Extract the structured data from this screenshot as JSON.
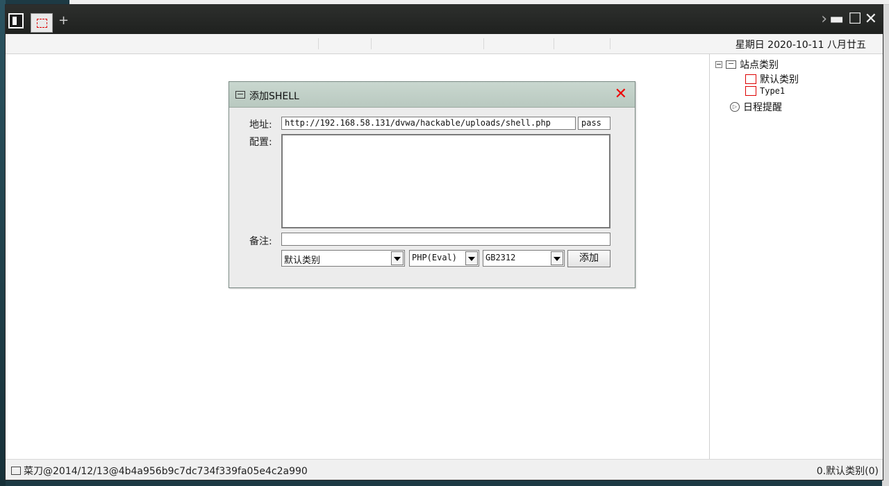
{
  "window": {
    "date": "星期日 2020-10-11 八月廿五"
  },
  "tree": {
    "root": "站点类别",
    "children": [
      "默认类别",
      "Type1"
    ],
    "schedule": "日程提醒"
  },
  "dialog": {
    "title": "添加SHELL",
    "url_label": "地址:",
    "url_value": "http://192.168.58.131/dvwa/hackable/uploads/shell.php",
    "password_value": "pass",
    "config_label": "配置:",
    "config_value": "",
    "note_label": "备注:",
    "note_value": "",
    "category_select": "默认类别",
    "type_select": "PHP(Eval)",
    "encoding_select": "GB2312",
    "add_button": "添加"
  },
  "status": {
    "left_text": "菜刀@2014/12/13@4b4a956b9c7dc734f339fa05e4c2a990",
    "right_text": "0.默认类别(0)"
  }
}
